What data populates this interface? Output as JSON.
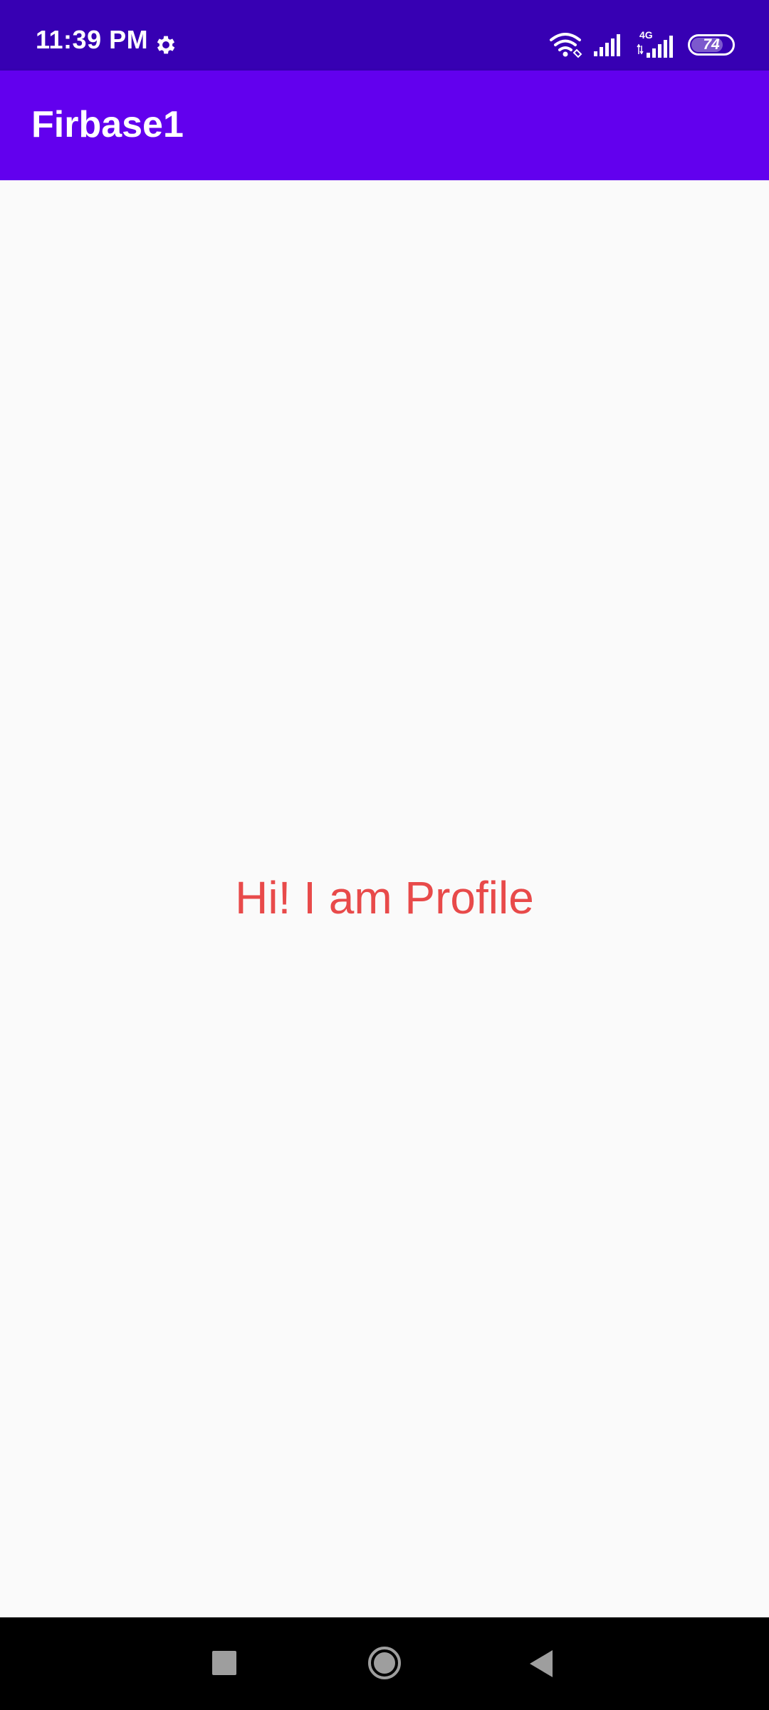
{
  "status_bar": {
    "time": "11:39 PM",
    "network_type": "4G",
    "battery_level": 74,
    "battery_text": "74",
    "background_color": "#3700b3",
    "icons": [
      "gear-icon",
      "wifi-icon",
      "signal-icon",
      "signal-icon",
      "battery-icon"
    ]
  },
  "app_bar": {
    "title": "Firbase1",
    "background_color": "#6200ee"
  },
  "main": {
    "message": "Hi! I am Profile",
    "message_color": "#e84a4a"
  },
  "nav_bar": {
    "buttons": [
      "recents-button",
      "home-button",
      "back-button"
    ]
  }
}
